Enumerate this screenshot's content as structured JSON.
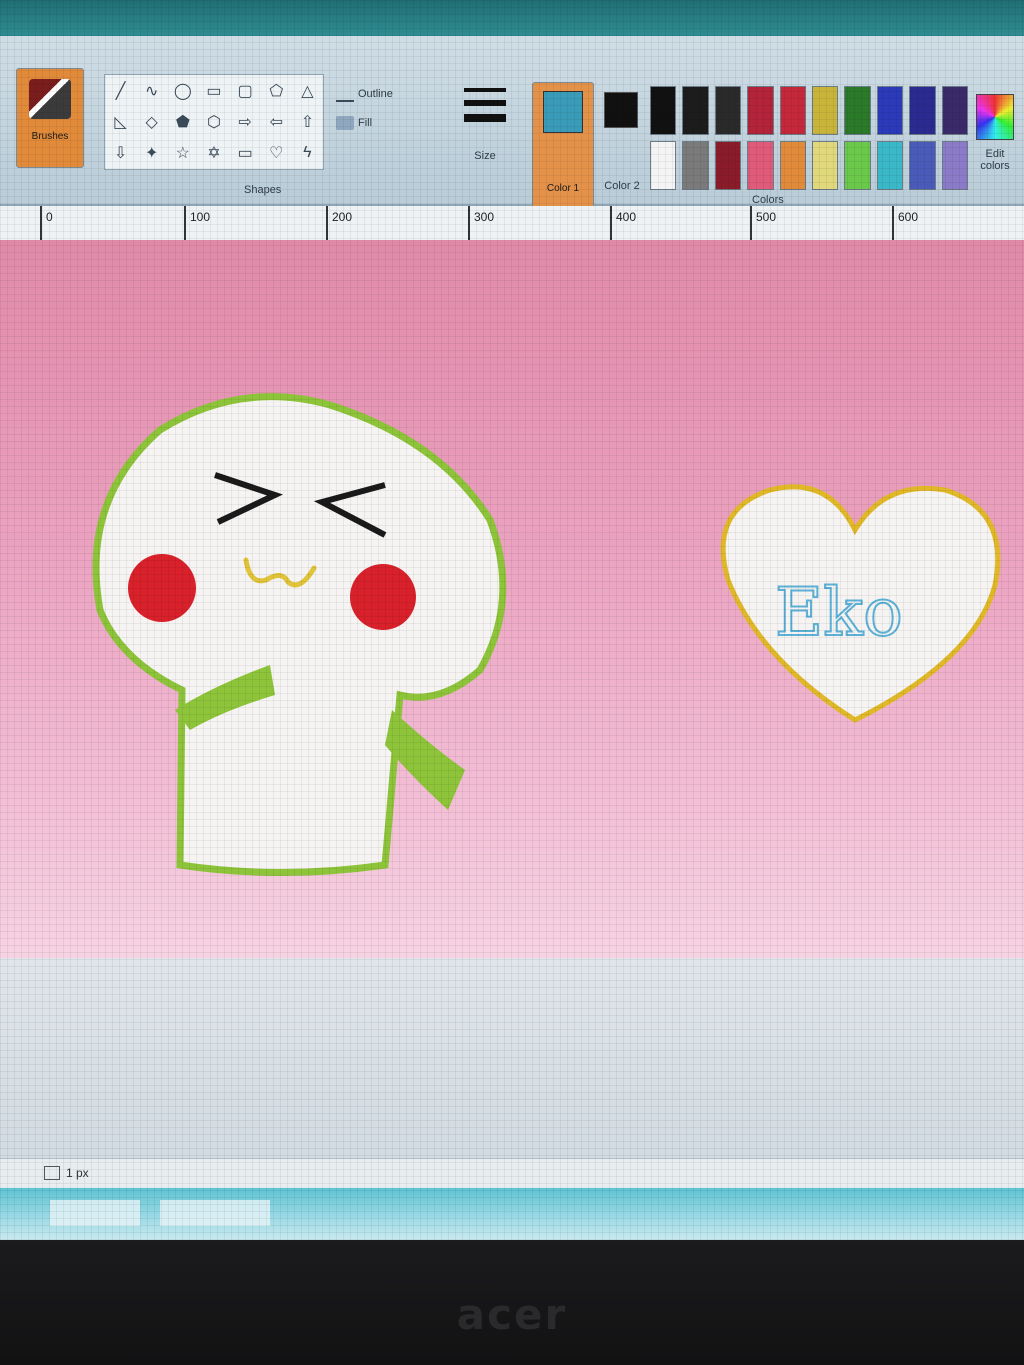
{
  "ribbon": {
    "brushes_label": "Brushes",
    "shapes_group_label": "Shapes",
    "outline_label": "Outline",
    "fill_label": "Fill",
    "size_label": "Size",
    "color1_label": "Color 1",
    "color2_label": "Color 2",
    "colors_group_label": "Colors",
    "edit_colors_label": "Edit colors",
    "palette": [
      "#111111",
      "#1c1c1c",
      "#2a2a2a",
      "#b3243a",
      "#c4283a",
      "#c9b43a",
      "#2a7a2a",
      "#2a3ab8",
      "#2a2a90",
      "#3a2a6a",
      "#f4f4f4",
      "#7a7a7a",
      "#8a1c2a",
      "#e05a7a",
      "#e08a3a",
      "#e0d87a",
      "#6ac84a",
      "#3ab8c8",
      "#4a5ab8",
      "#8a7ac8"
    ]
  },
  "ruler": {
    "ticks": [
      "0",
      "100",
      "200",
      "300",
      "400",
      "500",
      "600"
    ]
  },
  "canvas": {
    "heart_text": "Eko"
  },
  "statusbar": {
    "position_text": "1 px"
  },
  "bezel": {
    "brand": "acer"
  }
}
